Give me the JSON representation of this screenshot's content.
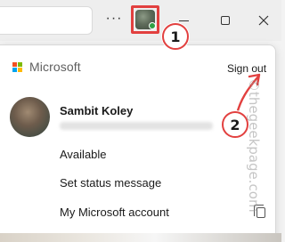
{
  "titlebar": {
    "more_icon_glyph": "···"
  },
  "flyout": {
    "brand": "Microsoft",
    "sign_out": "Sign out",
    "user": {
      "name": "Sambit Koley"
    },
    "menu": {
      "available": "Available",
      "set_status": "Set status message",
      "account": "My Microsoft account"
    }
  },
  "annotations": {
    "step1": "1",
    "step2": "2",
    "color": "#e2403f"
  },
  "watermark": "©thegeekpage.com"
}
